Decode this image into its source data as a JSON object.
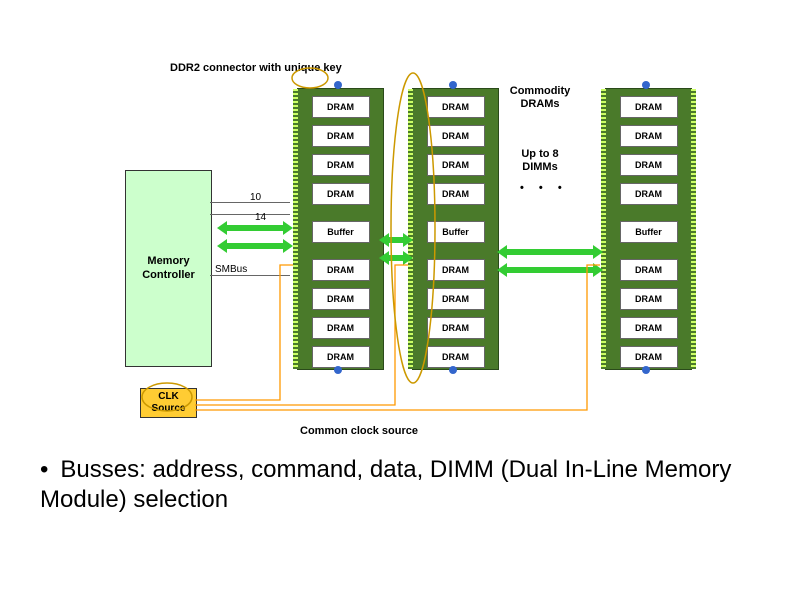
{
  "top_label": "DDR2 connector with unique key",
  "commodity_label_line1": "Commodity",
  "commodity_label_line2": "DRAMs",
  "up_to_label_line1": "Up to 8",
  "up_to_label_line2": "DIMMs",
  "dots": "• • •",
  "mem_ctrl_line1": "Memory",
  "mem_ctrl_line2": "Controller",
  "clk_line1": "CLK",
  "clk_line2": "Source",
  "bus_label_10": "10",
  "bus_label_14": "14",
  "smbus_label": "SMBus",
  "bottom_label": "Common clock source",
  "dram_label": "DRAM",
  "buffer_label": "Buffer",
  "bullet": "Busses: address, command, data, DIMM (Dual In-Line Memory Module) selection",
  "colors": {
    "dimm_green": "#4a7a2a",
    "light_green": "#ccffcc",
    "orange": "#ffcc33",
    "arrow_green": "#33cc33"
  }
}
